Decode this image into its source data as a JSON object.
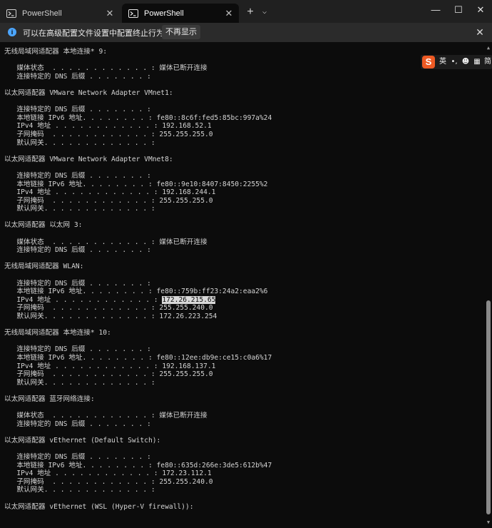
{
  "window": {
    "tabs": [
      {
        "label": "PowerShell",
        "active": false
      },
      {
        "label": "PowerShell",
        "active": true
      }
    ],
    "controls": {
      "minimize": "—",
      "maximize": "☐",
      "close": "✕"
    }
  },
  "infobar": {
    "message": "可以在高级配置文件设置中配置终止行为。",
    "dismiss_button": "不再显示"
  },
  "ime_toolbar": {
    "logo": "S",
    "items": [
      "英",
      "•,",
      "☻",
      "▦",
      "简"
    ]
  },
  "colors": {
    "background": "#0c0c0c",
    "text": "#d4d4d4",
    "titlebar": "#202020",
    "infobar": "#2b2b2b",
    "info_accent": "#4ca6ff",
    "selection": "#d9d9d9"
  },
  "terminal": {
    "lines": [
      "无线局域网适配器 本地连接* 9:",
      "",
      "   媒体状态  . . . . . . . . . . . . : 媒体已断开连接",
      "   连接特定的 DNS 后缀 . . . . . . . :",
      "",
      "以太网适配器 VMware Network Adapter VMnet1:",
      "",
      "   连接特定的 DNS 后缀 . . . . . . . :",
      "   本地链接 IPv6 地址. . . . . . . . : fe80::8c6f:fed5:85bc:997a%24",
      "   IPv4 地址 . . . . . . . . . . . . : 192.168.52.1",
      "   子网掩码  . . . . . . . . . . . . : 255.255.255.0",
      "   默认网关. . . . . . . . . . . . . :",
      "",
      "以太网适配器 VMware Network Adapter VMnet8:",
      "",
      "   连接特定的 DNS 后缀 . . . . . . . :",
      "   本地链接 IPv6 地址. . . . . . . . : fe80::9e10:8407:8450:2255%2",
      "   IPv4 地址 . . . . . . . . . . . . : 192.168.244.1",
      "   子网掩码  . . . . . . . . . . . . : 255.255.255.0",
      "   默认网关. . . . . . . . . . . . . :",
      "",
      "以太网适配器 以太网 3:",
      "",
      "   媒体状态  . . . . . . . . . . . . : 媒体已断开连接",
      "   连接特定的 DNS 后缀 . . . . . . . :",
      "",
      "无线局域网适配器 WLAN:",
      "",
      "   连接特定的 DNS 后缀 . . . . . . . :",
      "   本地链接 IPv6 地址. . . . . . . . : fe80::759b:ff23:24a2:eaa2%6",
      "   IPv4 地址 . . . . . . . . . . . . : 172.26.215.65",
      "   子网掩码  . . . . . . . . . . . . : 255.255.240.0",
      "   默认网关. . . . . . . . . . . . . : 172.26.223.254",
      "",
      "无线局域网适配器 本地连接* 10:",
      "",
      "   连接特定的 DNS 后缀 . . . . . . . :",
      "   本地链接 IPv6 地址. . . . . . . . : fe80::12ee:db9e:ce15:c0a6%17",
      "   IPv4 地址 . . . . . . . . . . . . : 192.168.137.1",
      "   子网掩码  . . . . . . . . . . . . : 255.255.255.0",
      "   默认网关. . . . . . . . . . . . . :",
      "",
      "以太网适配器 蓝牙网络连接:",
      "",
      "   媒体状态  . . . . . . . . . . . . : 媒体已断开连接",
      "   连接特定的 DNS 后缀 . . . . . . . :",
      "",
      "以太网适配器 vEthernet (Default Switch):",
      "",
      "   连接特定的 DNS 后缀 . . . . . . . :",
      "   本地链接 IPv6 地址. . . . . . . . : fe80::635d:266e:3de5:612b%47",
      "   IPv4 地址 . . . . . . . . . . . . : 172.23.112.1",
      "   子网掩码  . . . . . . . . . . . . : 255.255.240.0",
      "   默认网关. . . . . . . . . . . . . :",
      "",
      "以太网适配器 vEthernet (WSL (Hyper-V firewall)):"
    ],
    "selection": {
      "line": 30,
      "text": "172.26.215.65"
    }
  }
}
